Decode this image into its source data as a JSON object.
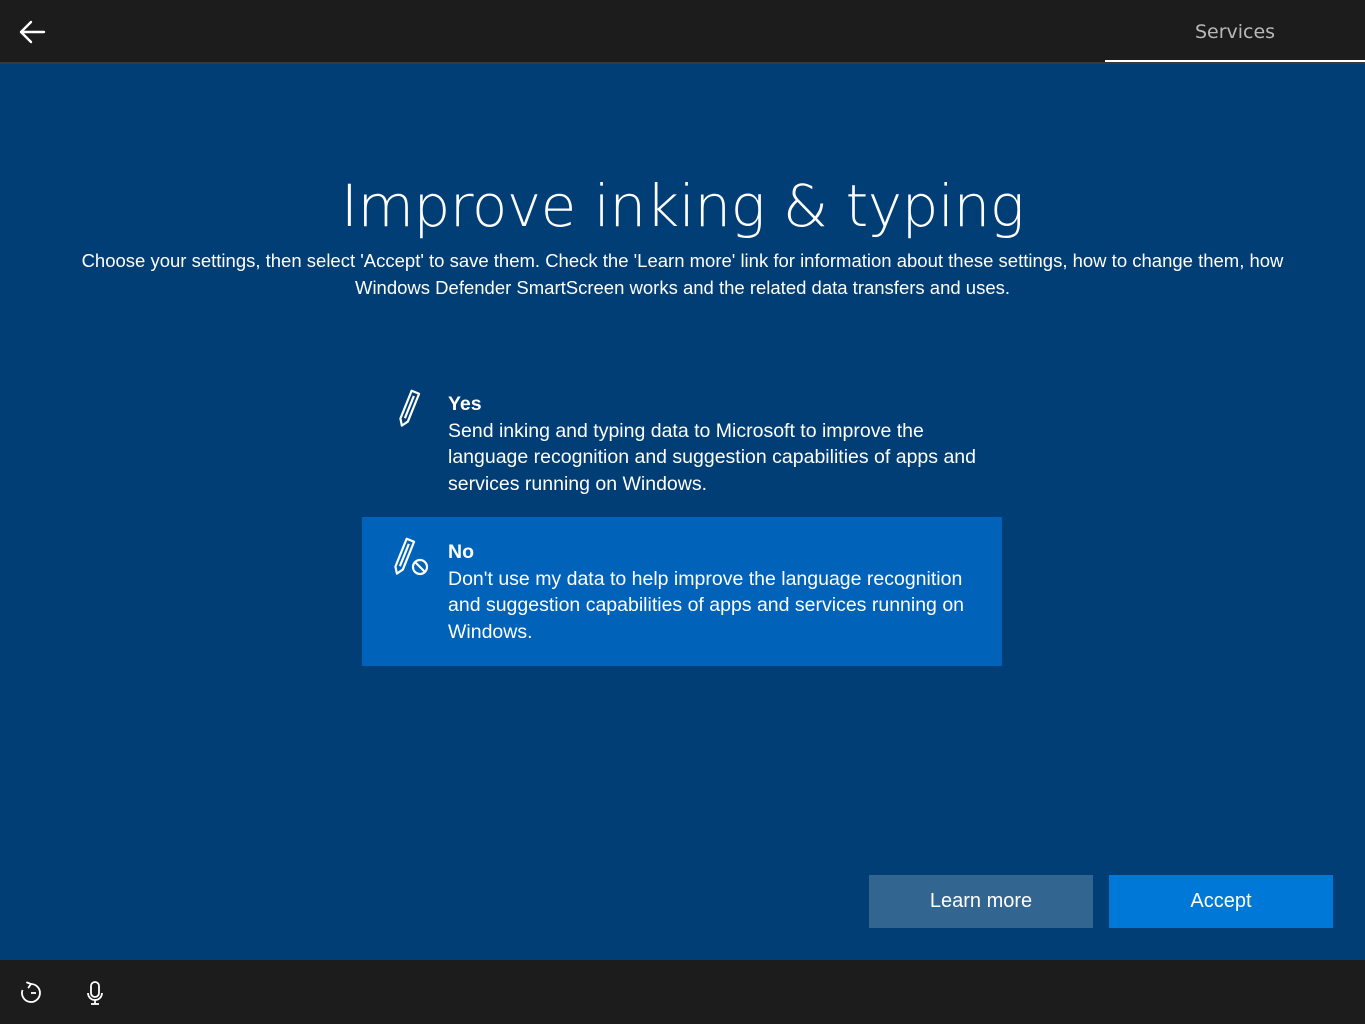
{
  "header": {
    "back_icon": "back-arrow-icon",
    "tab_label": "Services"
  },
  "main": {
    "title": "Improve inking & typing",
    "subtitle": "Choose your settings, then select 'Accept' to save them. Check the 'Learn more' link for information about these settings, how to change them, how Windows Defender SmartScreen works and the related data transfers and uses.",
    "options": [
      {
        "title": "Yes",
        "description": "Send inking and typing data to Microsoft to improve the language recognition and suggestion capabilities of apps and services running on Windows.",
        "icon": "pen-icon",
        "selected": false
      },
      {
        "title": "No",
        "description": "Don't use my data to help improve the language recognition and suggestion capabilities of apps and services running on Windows.",
        "icon": "pen-blocked-icon",
        "selected": true
      }
    ]
  },
  "buttons": {
    "learn_more": "Learn more",
    "accept": "Accept"
  },
  "footer": {
    "icons": [
      "ease-of-access-icon",
      "microphone-icon"
    ]
  },
  "colors": {
    "background": "#003e75",
    "bar": "#1b1c1b",
    "selected_option": "#0063b9",
    "accept_button": "#0078d7",
    "learn_more_button": "#336591"
  }
}
